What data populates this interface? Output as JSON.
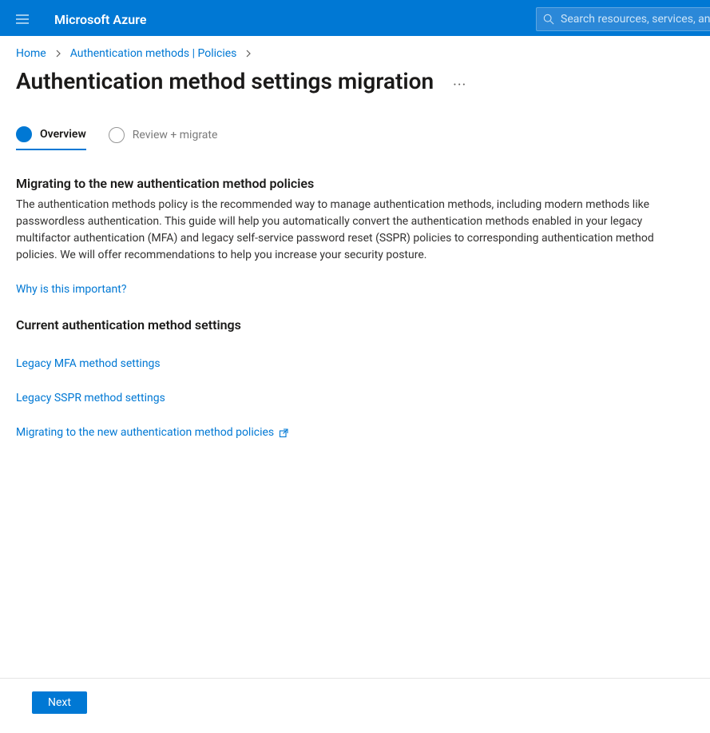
{
  "header": {
    "brand": "Microsoft Azure",
    "search_placeholder": "Search resources, services, and"
  },
  "breadcrumbs": {
    "home": "Home",
    "policies": "Authentication methods | Policies"
  },
  "page": {
    "title": "Authentication method settings migration",
    "ellipsis": "···"
  },
  "tabs": {
    "overview": "Overview",
    "review": "Review + migrate"
  },
  "section1": {
    "heading": "Migrating to the new authentication method policies",
    "body": "The authentication methods policy is the recommended way to manage authentication methods, including modern methods like passwordless authentication. This guide will help you automatically convert the authentication methods enabled in your legacy multifactor authentication (MFA) and legacy self-service password reset (SSPR) policies to corresponding authentication method policies. We will offer recommendations to help you increase your security posture.",
    "why_link": "Why is this important?"
  },
  "section2": {
    "heading": "Current authentication method settings",
    "link_mfa": "Legacy MFA method settings",
    "link_sspr": "Legacy SSPR method settings",
    "link_migrate": "Migrating to the new authentication method policies"
  },
  "footer": {
    "next": "Next"
  }
}
